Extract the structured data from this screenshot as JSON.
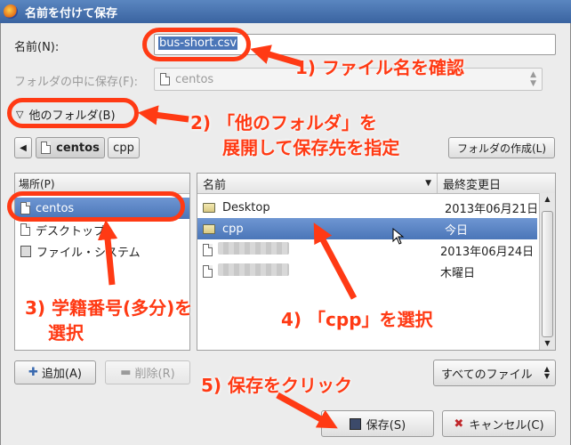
{
  "window": {
    "title": "名前を付けて保存"
  },
  "name_row": {
    "label": "名前(N):",
    "value": "bus-short.csv"
  },
  "save_in_row": {
    "label": "フォルダの中に保存(F):",
    "value": "centos"
  },
  "other_folders": {
    "label": "他のフォルダ(B)"
  },
  "path_bar": {
    "items": [
      "centos",
      "cpp"
    ],
    "create_folder_label": "フォルダの作成(L)"
  },
  "places": {
    "header": "場所(P)",
    "items": [
      "centos",
      "デスクトップ",
      "ファイル・システム"
    ]
  },
  "files": {
    "header_name": "名前",
    "header_modified": "最終変更日",
    "rows": [
      {
        "name": "Desktop",
        "modified": "2013年06月21日"
      },
      {
        "name": "cpp",
        "modified": "今日"
      },
      {
        "name": "",
        "modified": "2013年06月24日"
      },
      {
        "name": "",
        "modified": "木曜日"
      }
    ]
  },
  "buttons": {
    "add": "追加(A)",
    "remove": "削除(R)",
    "save": "保存(S)",
    "cancel": "キャンセル(C)"
  },
  "filter": {
    "value": "すべてのファイル"
  },
  "annotations": {
    "a1": "1) ファイル名を確認",
    "a2_line1": "2) 「他のフォルダ」を",
    "a2_line2": "展開して保存先を指定",
    "a3_line1": "3) 学籍番号(多分)を",
    "a3_line2": "選択",
    "a4": "4) 「cpp」を選択",
    "a5": "5) 保存をクリック"
  },
  "colors": {
    "annotation": "#ff3a14",
    "selection": "#4b76b8",
    "titlebar": "#3a63a0"
  }
}
